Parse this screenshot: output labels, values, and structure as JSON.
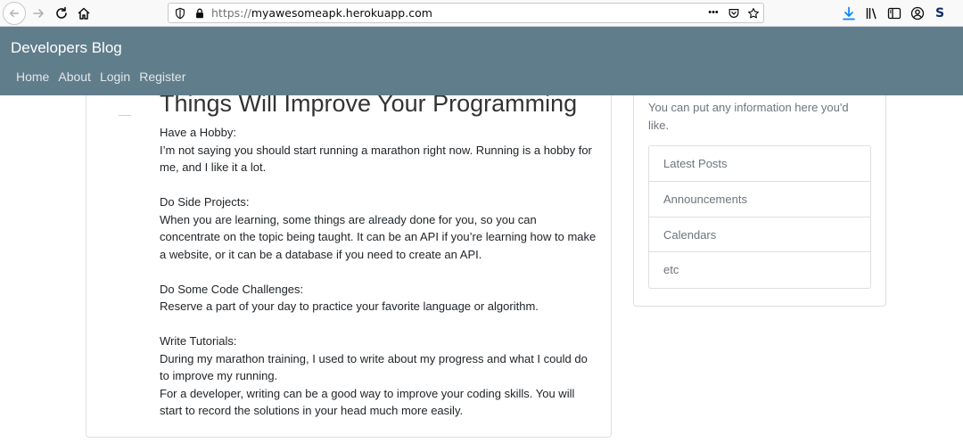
{
  "browser": {
    "url_protocol": "https://",
    "url_host": "myawesomeapk.herokuapp.com",
    "url_menu": "•••",
    "profile_letter": "S"
  },
  "site": {
    "brand": "Developers Blog",
    "nav": [
      "Home",
      "About",
      "Login",
      "Register"
    ],
    "accent_color": "#607d8b"
  },
  "post": {
    "title": "Things Will Improve Your Programming",
    "sections": [
      {
        "heading": "Have a Hobby:",
        "lines": [
          "I’m not saying you should start running a marathon right now. Running is a hobby for",
          "me, and I like it a lot."
        ]
      },
      {
        "heading": "Do Side Projects:",
        "lines": [
          "When you are learning, some things are already done for you, so you can",
          "concentrate on the topic being taught. It can be an API if you’re learning how to make",
          "a website, or it can be a database if you need to create an API."
        ]
      },
      {
        "heading": "Do Some Code Challenges:",
        "lines": [
          "Reserve a part of your day to practice your favorite language or algorithm."
        ]
      },
      {
        "heading": "Write Tutorials:",
        "lines": [
          "During my marathon training, I used to write about my progress and what I could do",
          "to improve my running.",
          "For a developer, writing can be a good way to improve your coding skills. You will",
          "start to record the solutions in your head much more easily."
        ]
      }
    ]
  },
  "sidebar": {
    "text_lines": [
      "You can put any information here you'd",
      "like."
    ],
    "items": [
      "Latest Posts",
      "Announcements",
      "Calendars",
      "etc"
    ]
  }
}
